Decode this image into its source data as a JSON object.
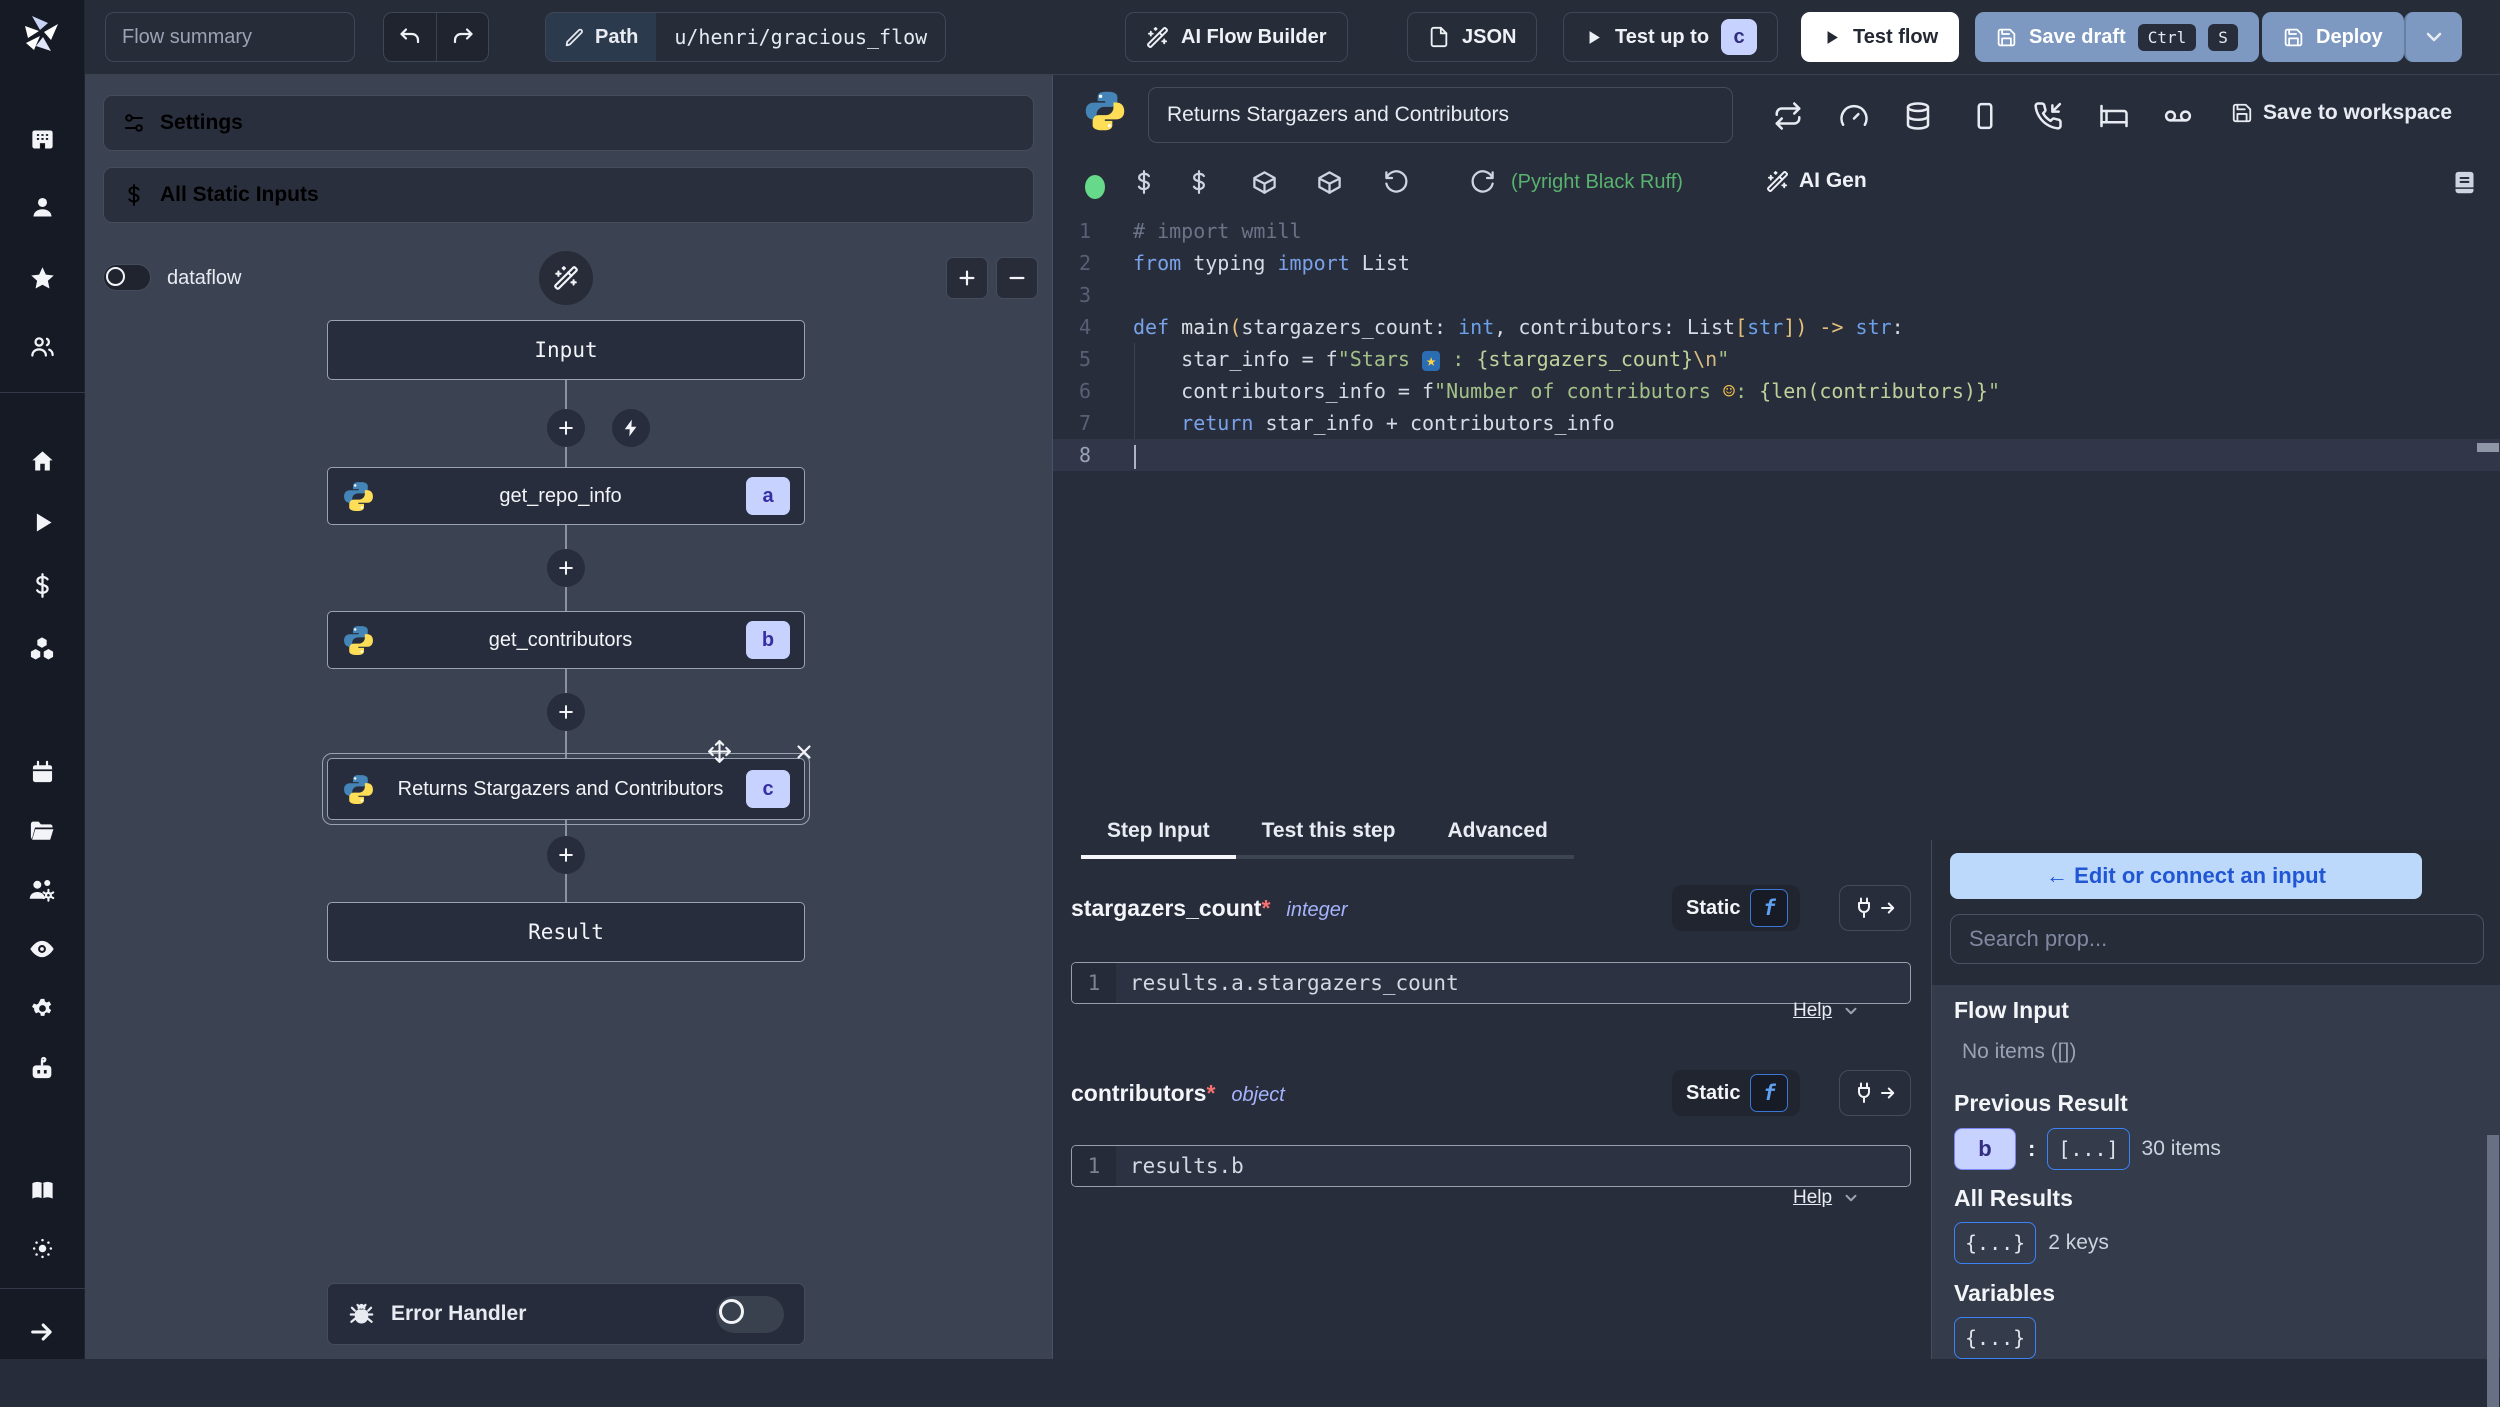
{
  "topbar": {
    "flow_summary_placeholder": "Flow summary",
    "path_label": "Path",
    "path_value": "u/henri/gracious_flow",
    "ai_flow_builder": "AI Flow Builder",
    "json_label": "JSON",
    "test_up_to": "Test up to",
    "test_up_to_badge": "c",
    "test_flow": "Test flow",
    "save_draft": "Save draft",
    "save_draft_kbd1": "Ctrl",
    "save_draft_kbd2": "S",
    "deploy": "Deploy"
  },
  "flow": {
    "settings_label": "Settings",
    "static_inputs_label": "All Static Inputs",
    "dataflow_label": "dataflow",
    "input_node": "Input",
    "result_node": "Result",
    "error_handler": "Error Handler",
    "steps": [
      {
        "id": "a",
        "label": "get_repo_info"
      },
      {
        "id": "b",
        "label": "get_contributors"
      },
      {
        "id": "c",
        "label": "Returns Stargazers and Contributors"
      }
    ]
  },
  "editor": {
    "step_name": "Returns Stargazers and Contributors",
    "save_to_workspace": "Save to workspace",
    "lint_status": "(Pyright Black Ruff)",
    "ai_gen_label": "AI Gen",
    "code": {
      "cursor_line": 8,
      "lines": [
        [
          [
            "cmt",
            "# import wmill"
          ]
        ],
        [
          [
            "kw",
            "from"
          ],
          [
            "df",
            " typing "
          ],
          [
            "kw",
            "import"
          ],
          [
            "df",
            " List"
          ]
        ],
        [],
        [
          [
            "kw",
            "def"
          ],
          [
            "df",
            " "
          ],
          [
            "fn",
            "main"
          ],
          [
            "pn",
            "("
          ],
          [
            "df",
            "stargazers_count: "
          ],
          [
            "ty",
            "int"
          ],
          [
            "df",
            ", contributors: "
          ],
          [
            "df",
            "List"
          ],
          [
            "pn",
            "["
          ],
          [
            "ty",
            "str"
          ],
          [
            "pn",
            "]"
          ],
          [
            "pn",
            ")"
          ],
          [
            "op",
            " -> "
          ],
          [
            "ty",
            "str"
          ],
          [
            "df",
            ":"
          ]
        ],
        [
          [
            "df",
            "    star_info = "
          ],
          [
            "df",
            "f"
          ],
          [
            "str",
            "\"Stars "
          ],
          [
            "em-star",
            "★"
          ],
          [
            "str",
            " : "
          ],
          [
            "ip",
            "{stargazers_count}"
          ],
          [
            "esc",
            "\\n"
          ],
          [
            "str",
            "\""
          ]
        ],
        [
          [
            "df",
            "    contributors_info = "
          ],
          [
            "df",
            "f"
          ],
          [
            "str",
            "\"Number of contributors "
          ],
          [
            "em-person",
            "☺"
          ],
          [
            "str",
            ": "
          ],
          [
            "ip",
            "{len(contributors)}"
          ],
          [
            "str",
            "\""
          ]
        ],
        [
          [
            "kw",
            "    return"
          ],
          [
            "df",
            " star_info + contributors_info"
          ]
        ],
        []
      ]
    }
  },
  "tabs": {
    "step_input": "Step Input",
    "test_this_step": "Test this step",
    "advanced": "Advanced"
  },
  "step_input": {
    "fields": [
      {
        "name": "stargazers_count",
        "required": "*",
        "type": "integer",
        "mode": "Static",
        "fx": "f",
        "line_no": "1",
        "expr": "results.a.stargazers_count",
        "help_label": "Help"
      },
      {
        "name": "contributors",
        "required": "*",
        "type": "object",
        "mode": "Static",
        "fx": "f",
        "line_no": "1",
        "expr": "results.b",
        "help_label": "Help"
      }
    ]
  },
  "connect": {
    "back_button": "← Edit or connect an input",
    "search_placeholder": "Search prop...",
    "flow_input_title": "Flow Input",
    "flow_input_empty": "No items ([])",
    "previous_result_title": "Previous Result",
    "previous_result_badge": "b",
    "previous_result_colon": ":",
    "previous_result_collapsed": "[...]",
    "previous_result_meta": "30 items",
    "all_results_title": "All Results",
    "all_results_collapsed": "{...}",
    "all_results_meta": "2 keys",
    "variables_title": "Variables",
    "variables_collapsed": "{...}"
  }
}
